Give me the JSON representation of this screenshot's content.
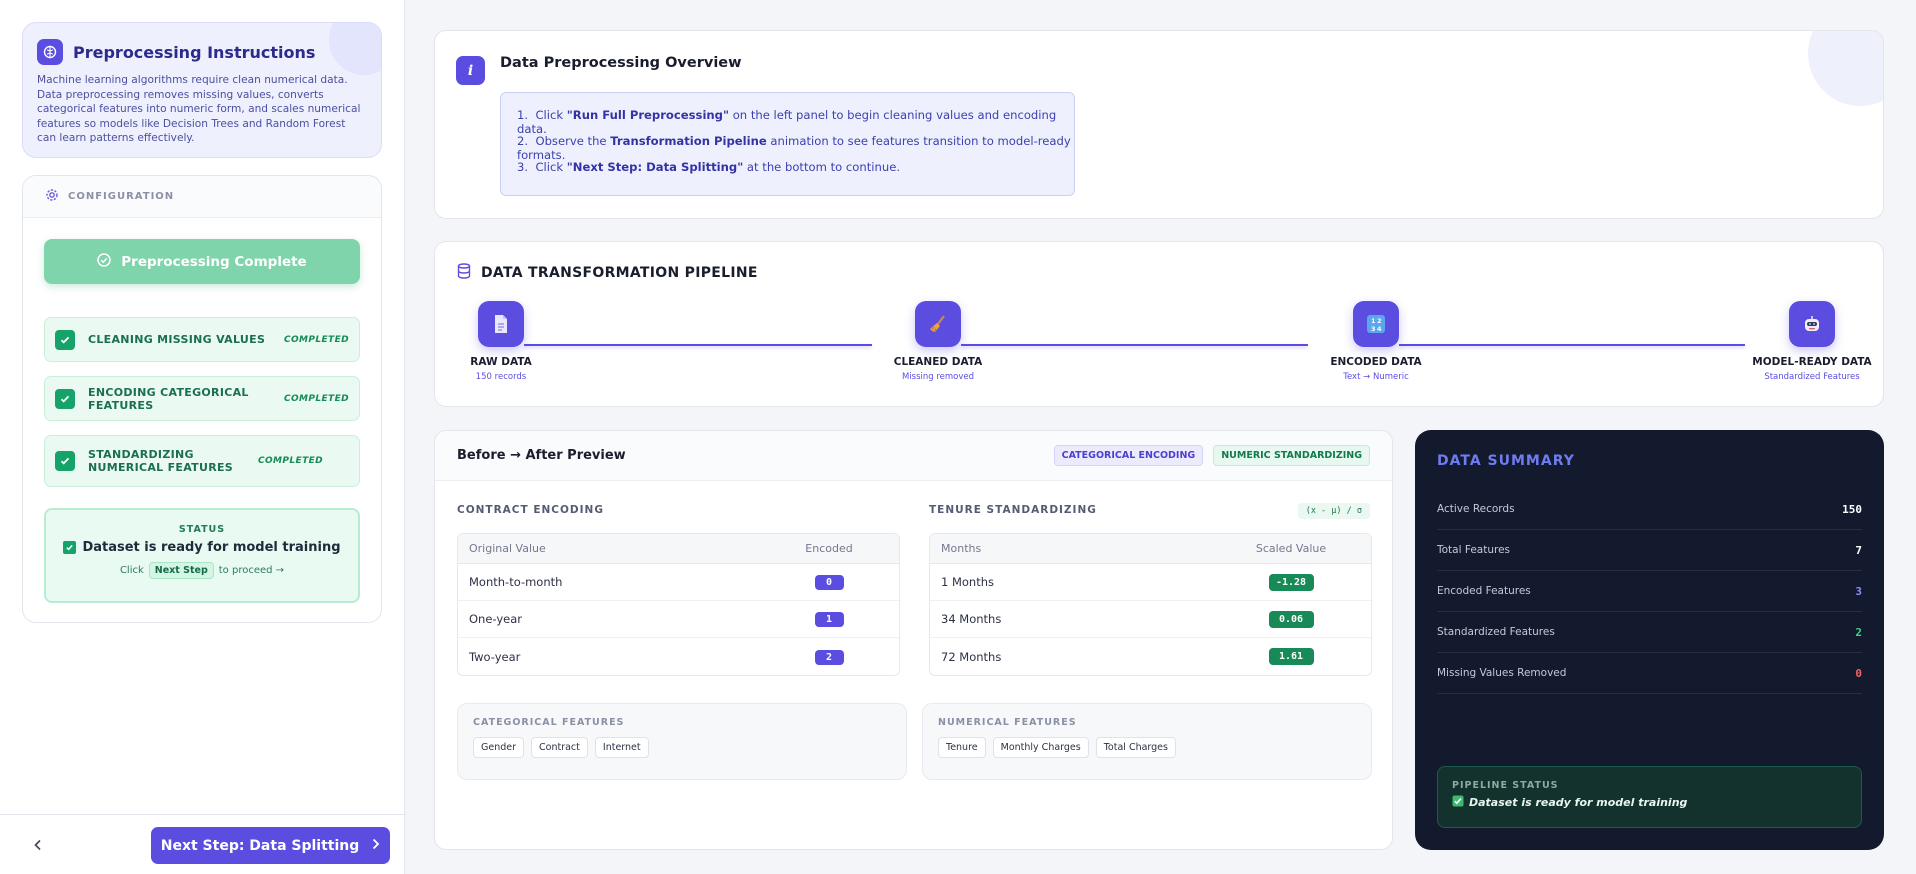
{
  "instructions": {
    "title": "Preprocessing Instructions",
    "text": "Machine learning algorithms require clean numerical data. Data preprocessing removes missing values, converts categorical features into numeric form, and scales numerical features so models like Decision Trees and Random Forest can learn patterns effectively."
  },
  "config": {
    "title": "CONFIGURATION",
    "run_button": "Preprocessing Complete",
    "steps": [
      {
        "label": "CLEANING MISSING VALUES",
        "status": "COMPLETED"
      },
      {
        "label": "ENCODING CATEGORICAL FEATURES",
        "status": "COMPLETED"
      },
      {
        "label": "STANDARDIZING NUMERICAL FEATURES",
        "status": "COMPLETED"
      }
    ],
    "status_box": {
      "caption": "STATUS",
      "message": "Dataset is ready for model training",
      "hint_prefix": "Click",
      "hint_key": "Next Step",
      "hint_suffix": "to proceed →"
    }
  },
  "footer": {
    "next_button": "Next Step: Data Splitting"
  },
  "overview": {
    "title": "Data Preprocessing Overview",
    "steps": [
      {
        "num": "1.",
        "pre": "Click ",
        "bold": "\"Run Full Preprocessing\"",
        "post": " on the left panel to begin cleaning values and encoding data."
      },
      {
        "num": "2.",
        "pre": "Observe the ",
        "bold": "Transformation Pipeline",
        "post": " animation to see features transition to model-ready formats."
      },
      {
        "num": "3.",
        "pre": "Click ",
        "bold": "\"Next Step: Data Splitting\"",
        "post": " at the bottom to continue."
      }
    ]
  },
  "pipeline": {
    "title": "DATA TRANSFORMATION PIPELINE",
    "stages": [
      {
        "label": "RAW DATA",
        "sub": "150 records",
        "icon": "document-icon"
      },
      {
        "label": "CLEANED DATA",
        "sub": "Missing removed",
        "icon": "broom-icon"
      },
      {
        "label": "ENCODED DATA",
        "sub": "Text → Numeric",
        "icon": "numbers-icon"
      },
      {
        "label": "MODEL-READY DATA",
        "sub": "Standardized Features",
        "icon": "robot-icon"
      }
    ]
  },
  "preview": {
    "title": "Before → After Preview",
    "tags": [
      "CATEGORICAL ENCODING",
      "NUMERIC STANDARDIZING"
    ],
    "contract": {
      "title": "CONTRACT ENCODING",
      "headers": [
        "Original Value",
        "Encoded"
      ],
      "rows": [
        {
          "orig": "Month-to-month",
          "val": "0"
        },
        {
          "orig": "One-year",
          "val": "1"
        },
        {
          "orig": "Two-year",
          "val": "2"
        }
      ]
    },
    "tenure": {
      "title": "TENURE STANDARDIZING",
      "formula": "(x - μ) / σ",
      "headers": [
        "Months",
        "Scaled Value"
      ],
      "rows": [
        {
          "orig": "1 Months",
          "val": "-1.28"
        },
        {
          "orig": "34 Months",
          "val": "0.06"
        },
        {
          "orig": "72 Months",
          "val": "1.61"
        }
      ]
    },
    "categorical": {
      "title": "CATEGORICAL FEATURES",
      "items": [
        "Gender",
        "Contract",
        "Internet"
      ]
    },
    "numerical": {
      "title": "NUMERICAL FEATURES",
      "items": [
        "Tenure",
        "Monthly Charges",
        "Total Charges"
      ]
    }
  },
  "summary": {
    "title": "DATA SUMMARY",
    "rows": [
      {
        "label": "Active Records",
        "value": "150",
        "color": "#ffffff"
      },
      {
        "label": "Total Features",
        "value": "7",
        "color": "#ffffff"
      },
      {
        "label": "Encoded Features",
        "value": "3",
        "color": "#8b8ff5"
      },
      {
        "label": "Standardized Features",
        "value": "2",
        "color": "#3fd08a"
      },
      {
        "label": "Missing Values Removed",
        "value": "0",
        "color": "#f26464"
      }
    ],
    "pipeline_status": {
      "caption": "PIPELINE STATUS",
      "message": "Dataset is ready for model training"
    }
  },
  "colors": {
    "accent": "#5b4de0",
    "success": "#16a36a",
    "dark_panel": "#141a2e"
  }
}
